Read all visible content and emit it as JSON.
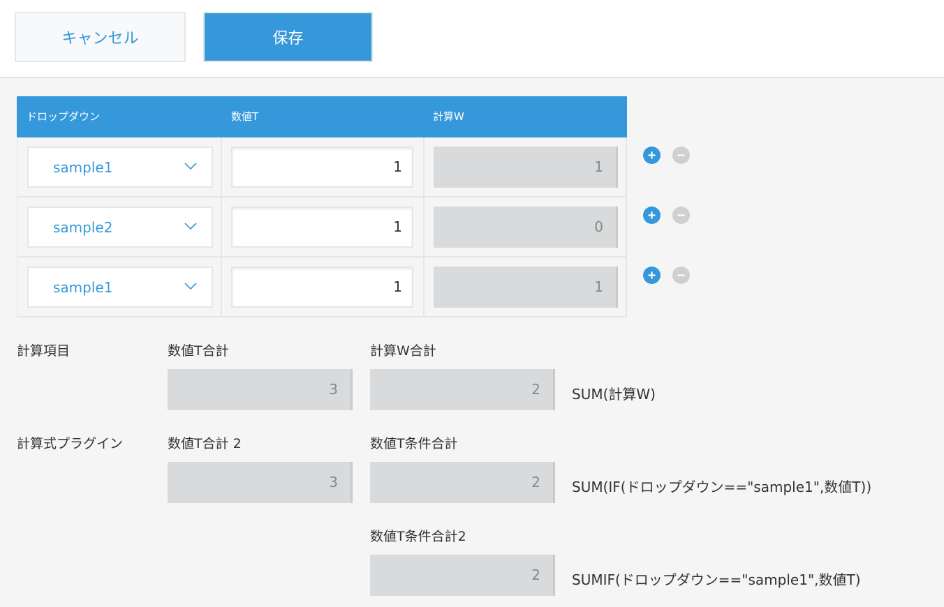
{
  "toolbar": {
    "cancel_label": "キャンセル",
    "save_label": "保存"
  },
  "subtable": {
    "headers": [
      "ドロップダウン",
      "数値T",
      "計算W"
    ],
    "rows": [
      {
        "dropdown": "sample1",
        "number": "1",
        "calc": "1"
      },
      {
        "dropdown": "sample2",
        "number": "1",
        "calc": "0"
      },
      {
        "dropdown": "sample1",
        "number": "1",
        "calc": "1"
      }
    ],
    "add_icon": "plus-circle-icon",
    "remove_icon": "minus-circle-icon",
    "dropdown_icon": "chevron-down-icon"
  },
  "sections": {
    "calc_item": {
      "label": "計算項目",
      "field1_label": "数値T合計",
      "field1_value": "3",
      "field2_label": "計算W合計",
      "field2_value": "2",
      "formula": "SUM(計算W)"
    },
    "plugin": {
      "label": "計算式プラグイン",
      "field1_label": "数値T合計 2",
      "field1_value": "3",
      "field2_label": "数値T条件合計",
      "field2_value": "2",
      "formula": "SUM(IF(ドロップダウン==\"sample1\",数値T))",
      "field3_label": "数値T条件合計2",
      "field3_value": "2",
      "formula3": "SUMIF(ドロップダウン==\"sample1\",数値T)"
    }
  },
  "colors": {
    "accent": "#3498db",
    "readonly_bg": "#d9dadb",
    "page_bg": "#f5f5f5",
    "remove_disabled": "#d0d0d0"
  }
}
